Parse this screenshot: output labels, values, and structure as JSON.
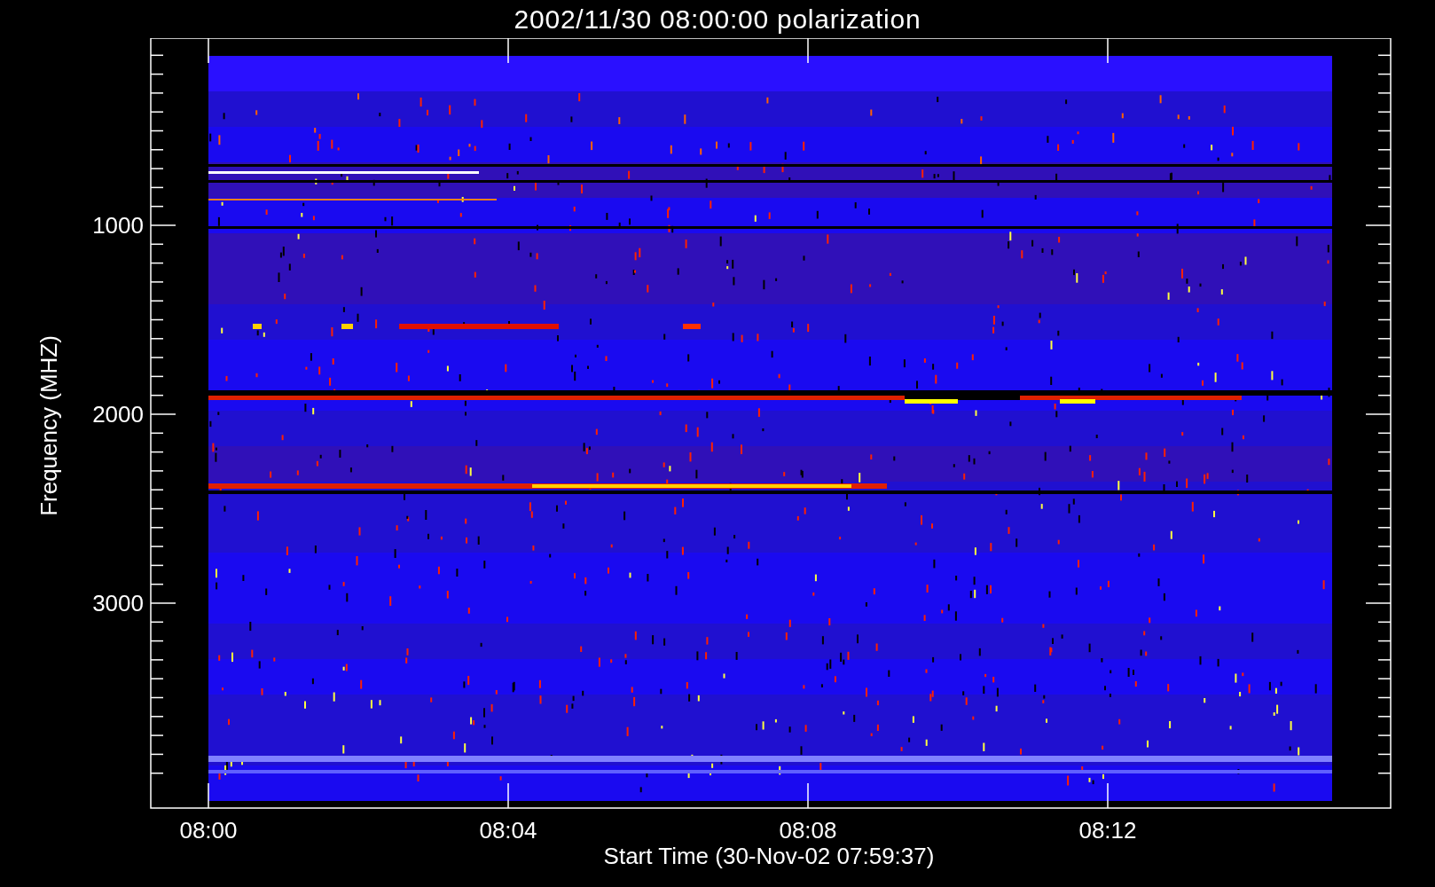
{
  "title": "2002/11/30 08:00:00 polarization",
  "y_axis": {
    "label": "Frequency (MHZ)",
    "ticks": [
      "1000",
      "2000",
      "3000"
    ]
  },
  "x_axis": {
    "label": "Start Time (30-Nov-02 07:59:37)",
    "ticks": [
      "08:00",
      "08:04",
      "08:08",
      "08:12"
    ]
  }
}
